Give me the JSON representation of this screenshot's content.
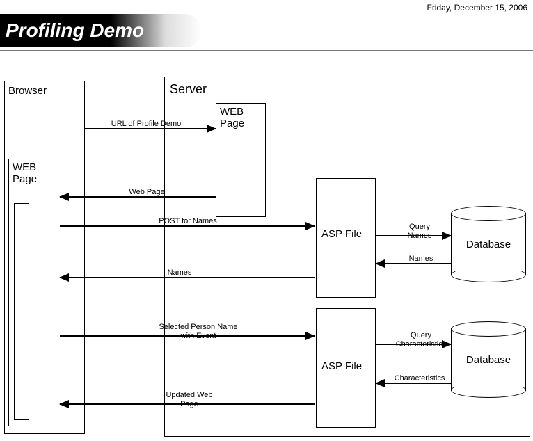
{
  "header": {
    "title": "Profiling Demo",
    "date": "Friday, December 15, 2006"
  },
  "browser": {
    "label": "Browser",
    "webpage_label": "WEB Page"
  },
  "server": {
    "label": "Server",
    "webpage_label": "WEB Page",
    "asp1_label": "ASP File",
    "asp2_label": "ASP File",
    "db1_label": "Database",
    "db2_label": "Database"
  },
  "arrows": {
    "url_label": "URL of Profile Demo",
    "webpage_label": "Web Page",
    "post_names_label": "POST for Names",
    "query_names_label": "Query Names",
    "names_back_label": "Names",
    "names_browser_label": "Names",
    "selected_person_label": "Selected Person Name with Event",
    "query_char_label": "Query Characteristics",
    "char_label": "Characteristics",
    "updated_label": "Updated Web Page"
  }
}
